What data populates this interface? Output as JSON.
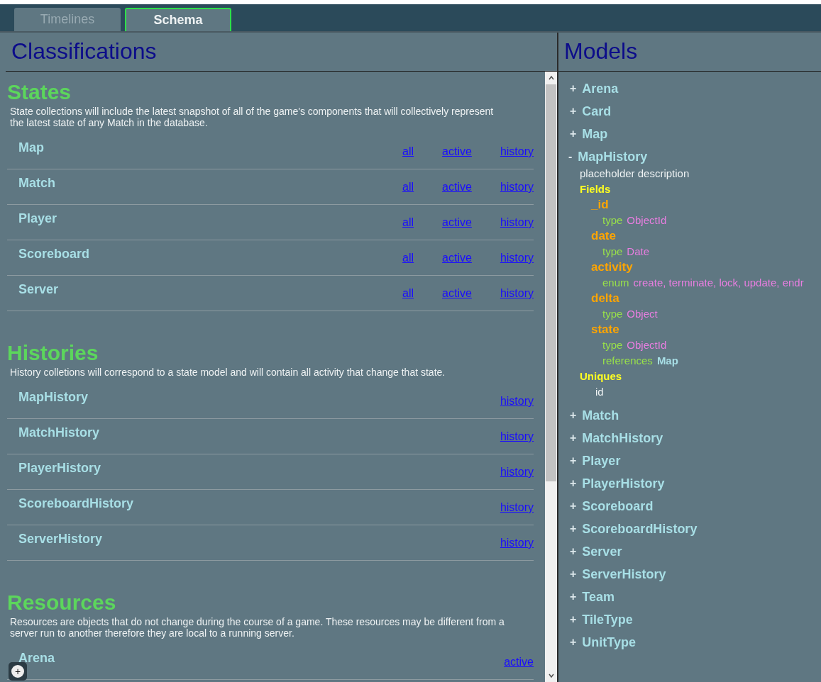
{
  "tabs": [
    {
      "label": "Timelines",
      "selected": false
    },
    {
      "label": "Schema",
      "selected": true
    }
  ],
  "classifications": {
    "title": "Classifications",
    "sections": [
      {
        "title": "States",
        "description": "State collections will include the latest snapshot of all of the game's components that will collectively represent the latest state of any Match in the database.",
        "rows": [
          {
            "name": "Map",
            "links": [
              "all",
              "active",
              "history"
            ]
          },
          {
            "name": "Match",
            "links": [
              "all",
              "active",
              "history"
            ]
          },
          {
            "name": "Player",
            "links": [
              "all",
              "active",
              "history"
            ]
          },
          {
            "name": "Scoreboard",
            "links": [
              "all",
              "active",
              "history"
            ]
          },
          {
            "name": "Server",
            "links": [
              "all",
              "active",
              "history"
            ]
          }
        ]
      },
      {
        "title": "Histories",
        "description": "History colletions will correspond to a state model and will contain all activity that change that state.",
        "rows": [
          {
            "name": "MapHistory",
            "links": [
              "history"
            ]
          },
          {
            "name": "MatchHistory",
            "links": [
              "history"
            ]
          },
          {
            "name": "PlayerHistory",
            "links": [
              "history"
            ]
          },
          {
            "name": "ScoreboardHistory",
            "links": [
              "history"
            ]
          },
          {
            "name": "ServerHistory",
            "links": [
              "history"
            ]
          }
        ]
      },
      {
        "title": "Resources",
        "description": "Resources are objects that do not change during the course of a game. These resources may be different from a server run to another therefore they are local to a running server.",
        "rows": [
          {
            "name": "Arena",
            "links": [
              "active"
            ]
          }
        ]
      }
    ]
  },
  "add_button": "+",
  "models": {
    "title": "Models",
    "items": [
      {
        "sign": "+",
        "name": "Arena",
        "expanded": false
      },
      {
        "sign": "+",
        "name": "Card",
        "expanded": false
      },
      {
        "sign": "+",
        "name": "Map",
        "expanded": false
      },
      {
        "sign": "-",
        "name": "MapHistory",
        "expanded": true,
        "description": "placeholder description",
        "fields_label": "Fields",
        "fields": [
          {
            "name": "_id",
            "attributes": [
              {
                "key": "type",
                "value": "ObjectId",
                "kind": "plain"
              }
            ]
          },
          {
            "name": "date",
            "attributes": [
              {
                "key": "type",
                "value": "Date",
                "kind": "plain"
              }
            ]
          },
          {
            "name": "activity",
            "attributes": [
              {
                "key": "enum",
                "value": "create, terminate, lock, update, endr",
                "kind": "plain"
              }
            ]
          },
          {
            "name": "delta",
            "attributes": [
              {
                "key": "type",
                "value": "Object",
                "kind": "plain"
              }
            ]
          },
          {
            "name": "state",
            "attributes": [
              {
                "key": "type",
                "value": "ObjectId",
                "kind": "plain"
              },
              {
                "key": "references",
                "value": "Map",
                "kind": "reference"
              }
            ]
          }
        ],
        "uniques_label": "Uniques",
        "uniques": [
          "id"
        ]
      },
      {
        "sign": "+",
        "name": "Match",
        "expanded": false
      },
      {
        "sign": "+",
        "name": "MatchHistory",
        "expanded": false
      },
      {
        "sign": "+",
        "name": "Player",
        "expanded": false
      },
      {
        "sign": "+",
        "name": "PlayerHistory",
        "expanded": false
      },
      {
        "sign": "+",
        "name": "Scoreboard",
        "expanded": false
      },
      {
        "sign": "+",
        "name": "ScoreboardHistory",
        "expanded": false
      },
      {
        "sign": "+",
        "name": "Server",
        "expanded": false
      },
      {
        "sign": "+",
        "name": "ServerHistory",
        "expanded": false
      },
      {
        "sign": "+",
        "name": "Team",
        "expanded": false
      },
      {
        "sign": "+",
        "name": "TileType",
        "expanded": false
      },
      {
        "sign": "+",
        "name": "UnitType",
        "expanded": false
      }
    ]
  }
}
